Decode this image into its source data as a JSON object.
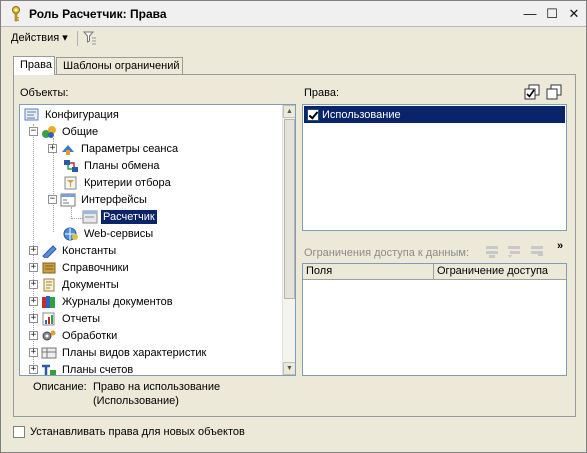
{
  "window": {
    "title": "Роль Расчетчик: Права",
    "minimize": "—",
    "maximize": "☐",
    "close": "✕"
  },
  "toolbar": {
    "actions_label": "Действия ▾"
  },
  "tabs": [
    {
      "label": "Права",
      "active": true
    },
    {
      "label": "Шаблоны ограничений",
      "active": false
    }
  ],
  "objects": {
    "label": "Объекты:",
    "tree": [
      {
        "label": "Конфигурация",
        "icon": "configuration-icon",
        "level": 0,
        "expander": "",
        "selected": false
      },
      {
        "label": "Общие",
        "icon": "common-icon",
        "level": 1,
        "expander": "−",
        "selected": false
      },
      {
        "label": "Параметры сеанса",
        "icon": "session-params-icon",
        "level": 2,
        "expander": "+",
        "selected": false
      },
      {
        "label": "Планы обмена",
        "icon": "exchange-plans-icon",
        "level": 2,
        "expander": "",
        "selected": false
      },
      {
        "label": "Критерии отбора",
        "icon": "filter-criteria-icon",
        "level": 2,
        "expander": "",
        "selected": false
      },
      {
        "label": "Интерфейсы",
        "icon": "interfaces-icon",
        "level": 2,
        "expander": "−",
        "selected": false
      },
      {
        "label": "Расчетчик",
        "icon": "interface-item-icon",
        "level": 3,
        "expander": "",
        "selected": true
      },
      {
        "label": "Web-сервисы",
        "icon": "web-services-icon",
        "level": 2,
        "expander": "",
        "selected": false
      },
      {
        "label": "Константы",
        "icon": "constants-icon",
        "level": 1,
        "expander": "+",
        "selected": false
      },
      {
        "label": "Справочники",
        "icon": "catalogs-icon",
        "level": 1,
        "expander": "+",
        "selected": false
      },
      {
        "label": "Документы",
        "icon": "documents-icon",
        "level": 1,
        "expander": "+",
        "selected": false
      },
      {
        "label": "Журналы документов",
        "icon": "document-journals-icon",
        "level": 1,
        "expander": "+",
        "selected": false
      },
      {
        "label": "Отчеты",
        "icon": "reports-icon",
        "level": 1,
        "expander": "+",
        "selected": false
      },
      {
        "label": "Обработки",
        "icon": "data-processors-icon",
        "level": 1,
        "expander": "+",
        "selected": false
      },
      {
        "label": "Планы видов характеристик",
        "icon": "characteristic-types-icon",
        "level": 1,
        "expander": "+",
        "selected": false
      },
      {
        "label": "Планы счетов",
        "icon": "chart-of-accounts-icon",
        "level": 1,
        "expander": "+",
        "selected": false
      }
    ]
  },
  "description": {
    "label": "Описание:",
    "line1": "Право на использование",
    "line2": "(Использование)"
  },
  "rights": {
    "label": "Права:",
    "items": [
      {
        "label": "Использование",
        "checked": true
      }
    ]
  },
  "restrictions": {
    "label": "Ограничения доступа к данным:",
    "columns": [
      "Поля",
      "Ограничение доступа"
    ],
    "more": "»"
  },
  "bottom": {
    "checkbox_label": "Устанавливать права для новых объектов",
    "checked": false
  },
  "colors": {
    "selection": "#0a246a",
    "window_bg": "#ece9d8",
    "border": "#7f9db9"
  }
}
